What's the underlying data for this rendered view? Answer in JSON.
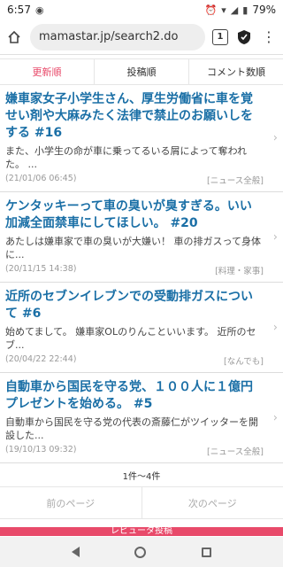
{
  "status": {
    "time": "6:57",
    "battery": "79%"
  },
  "browser": {
    "url": "mamastar.jp/search2.do",
    "tab_count": "1"
  },
  "sort_tabs": [
    {
      "label": "更新順",
      "active": true
    },
    {
      "label": "投稿順",
      "active": false
    },
    {
      "label": "コメント数順",
      "active": false
    }
  ],
  "items": [
    {
      "title": "嫌車家女子小学生さん、厚生労働省に車を覚せい剤や大麻みたく法律で禁止のお願いしをする #16",
      "excerpt": "また、小学生の命が車に乗ってるいる屑によって奪われた。 ...",
      "date": "(21/01/06 06:45)",
      "category": "[ニュース全般]"
    },
    {
      "title": "ケンタッキーって車の臭いが臭すぎる。いい加減全面禁車にしてほしい。 #20",
      "excerpt": "あたしは嫌車家で車の臭いが大嫌い！ 車の排ガスって身体に...",
      "date": "(20/11/15 14:38)",
      "category": "[料理・家事]"
    },
    {
      "title": "近所のセブンイレブンでの受動排ガスについて #6",
      "excerpt": "始めてまして。 嫌車家OLのりんこといいます。 近所のセブ...",
      "date": "(20/04/22 22:44)",
      "category": "[なんでも]"
    },
    {
      "title": "自動車から国民を守る党、１００人に１億円プレゼントを始める。 #5",
      "excerpt": "自動車から国民を守る党の代表の斎藤仁がツイッターを開設した...",
      "date": "(19/10/13 09:32)",
      "category": "[ニュース全般]"
    }
  ],
  "pager": {
    "count": "1件～4件",
    "prev": "前のページ",
    "next": "次のページ"
  },
  "banner": {
    "label": "レビュータ投稿"
  },
  "colors": {
    "accent": "#e84a6a",
    "link": "#1a6fa6"
  }
}
